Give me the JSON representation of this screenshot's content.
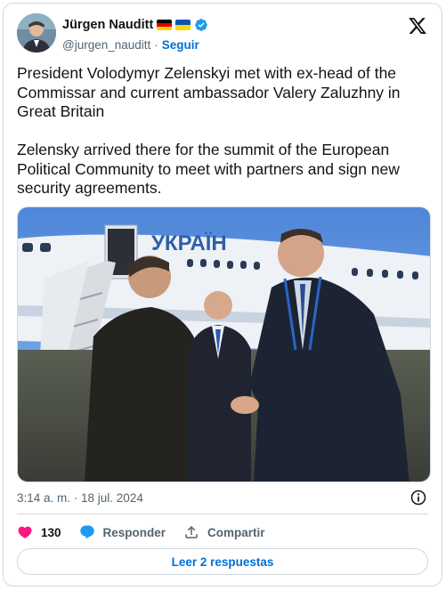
{
  "author": {
    "name": "Jürgen Nauditt",
    "handle": "@jurgen_nauditt",
    "separator": "·",
    "follow_label": "Seguir"
  },
  "icons": {
    "avatar": "avatar",
    "flag_1": "germany-flag-icon",
    "flag_2": "ukraine-flag-icon",
    "verified": "verified-badge-icon",
    "logo": "x-logo-icon",
    "info": "info-icon",
    "like": "heart-icon",
    "reply": "reply-bubble-icon",
    "share": "share-icon"
  },
  "tweet": {
    "text": "President Volodymyr Zelenskyi met with ex-head of the Commissar and current ambassador Valery Zaluzhny in Great Britain\n\nZelensky arrived there for the summit of the European Political Community to meet with partners and sign new security agreements.",
    "timestamp": "3:14 a. m. · 18 jul. 2024",
    "photo_fuselage_text": "УКРАЇН"
  },
  "actions": {
    "likes": "130",
    "reply_label": "Responder",
    "share_label": "Compartir",
    "read_replies_label": "Leer 2 respuestas"
  },
  "colors": {
    "like": "#f91880",
    "reply": "#1d9bf0",
    "link": "#006fd6",
    "muted": "#536471",
    "verified": "#1d9bf0",
    "border": "#cfd9de"
  }
}
